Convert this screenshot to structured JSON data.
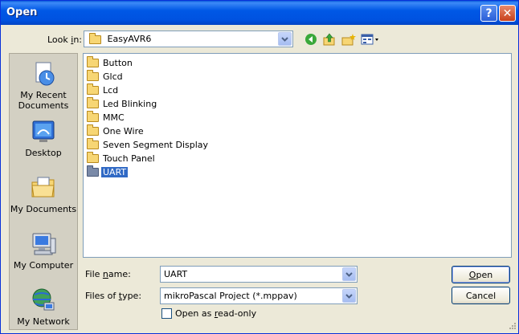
{
  "window": {
    "title": "Open",
    "help_glyph": "?",
    "close_glyph": "✕"
  },
  "lookin": {
    "label_prefix": "Look ",
    "label_accel": "i",
    "label_suffix": "n:",
    "value": "EasyAVR6"
  },
  "toolbar": {
    "icons": [
      "back-icon",
      "up-folder-icon",
      "new-folder-icon",
      "view-menu-icon"
    ]
  },
  "places": [
    {
      "line1": "My Recent",
      "line2": "Documents",
      "icon": "recent-documents-icon"
    },
    {
      "line1": "Desktop",
      "line2": "",
      "icon": "desktop-icon"
    },
    {
      "line1": "My Documents",
      "line2": "",
      "icon": "my-documents-icon"
    },
    {
      "line1": "My Computer",
      "line2": "",
      "icon": "my-computer-icon"
    },
    {
      "line1": "My Network",
      "line2": "",
      "icon": "my-network-icon"
    }
  ],
  "files": [
    {
      "name": "Button",
      "selected": false
    },
    {
      "name": "Glcd",
      "selected": false
    },
    {
      "name": "Lcd",
      "selected": false
    },
    {
      "name": "Led Blinking",
      "selected": false
    },
    {
      "name": "MMC",
      "selected": false
    },
    {
      "name": "One Wire",
      "selected": false
    },
    {
      "name": "Seven Segment Display",
      "selected": false
    },
    {
      "name": "Touch Panel",
      "selected": false
    },
    {
      "name": "UART",
      "selected": true
    }
  ],
  "filename": {
    "label_prefix": "File ",
    "label_accel": "n",
    "label_suffix": "ame:",
    "value": "UART"
  },
  "filetype": {
    "label_prefix": "Files of ",
    "label_accel": "t",
    "label_suffix": "ype:",
    "value": "mikroPascal Project (*.mppav)"
  },
  "readonly": {
    "label_prefix": "Open as ",
    "label_accel": "r",
    "label_suffix": "ead-only",
    "checked": false
  },
  "buttons": {
    "open_accel": "O",
    "open_rest": "pen",
    "cancel": "Cancel"
  },
  "colors": {
    "titlebar": "#0058e6",
    "selection": "#316ac5",
    "folder": "#f7d674"
  }
}
